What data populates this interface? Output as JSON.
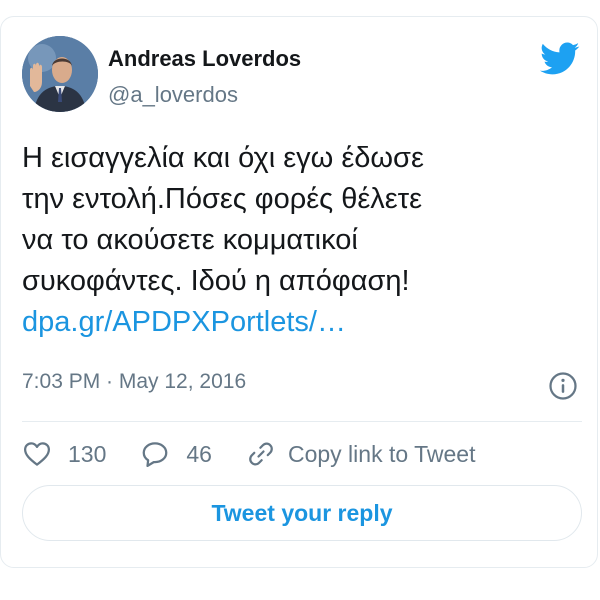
{
  "author": {
    "name": "Andreas Loverdos",
    "handle": "@a_loverdos"
  },
  "tweet": {
    "lines": [
      "Η εισαγγελία και όχι εγω έδωσε",
      "την εντολή.Πόσες φορές θέλετε",
      "να το ακούσετε κομματικοί",
      "συκοφάντες. Ιδού η απόφαση!"
    ],
    "link": "dpa.gr/APDPXPortlets/…",
    "timestamp": "7:03 PM · May 12, 2016"
  },
  "actions": {
    "likes": "130",
    "replies": "46",
    "copy_link_label": "Copy link to Tweet"
  },
  "reply_button_label": "Tweet your reply",
  "icons": {
    "brand": "twitter-bird-icon",
    "info": "info-icon",
    "like": "heart-icon",
    "reply": "speech-bubble-icon",
    "copy": "link-icon"
  },
  "colors": {
    "accent": "#1b95e0",
    "text": "#14171a",
    "secondary": "#657786",
    "border": "#e6ecf0"
  }
}
